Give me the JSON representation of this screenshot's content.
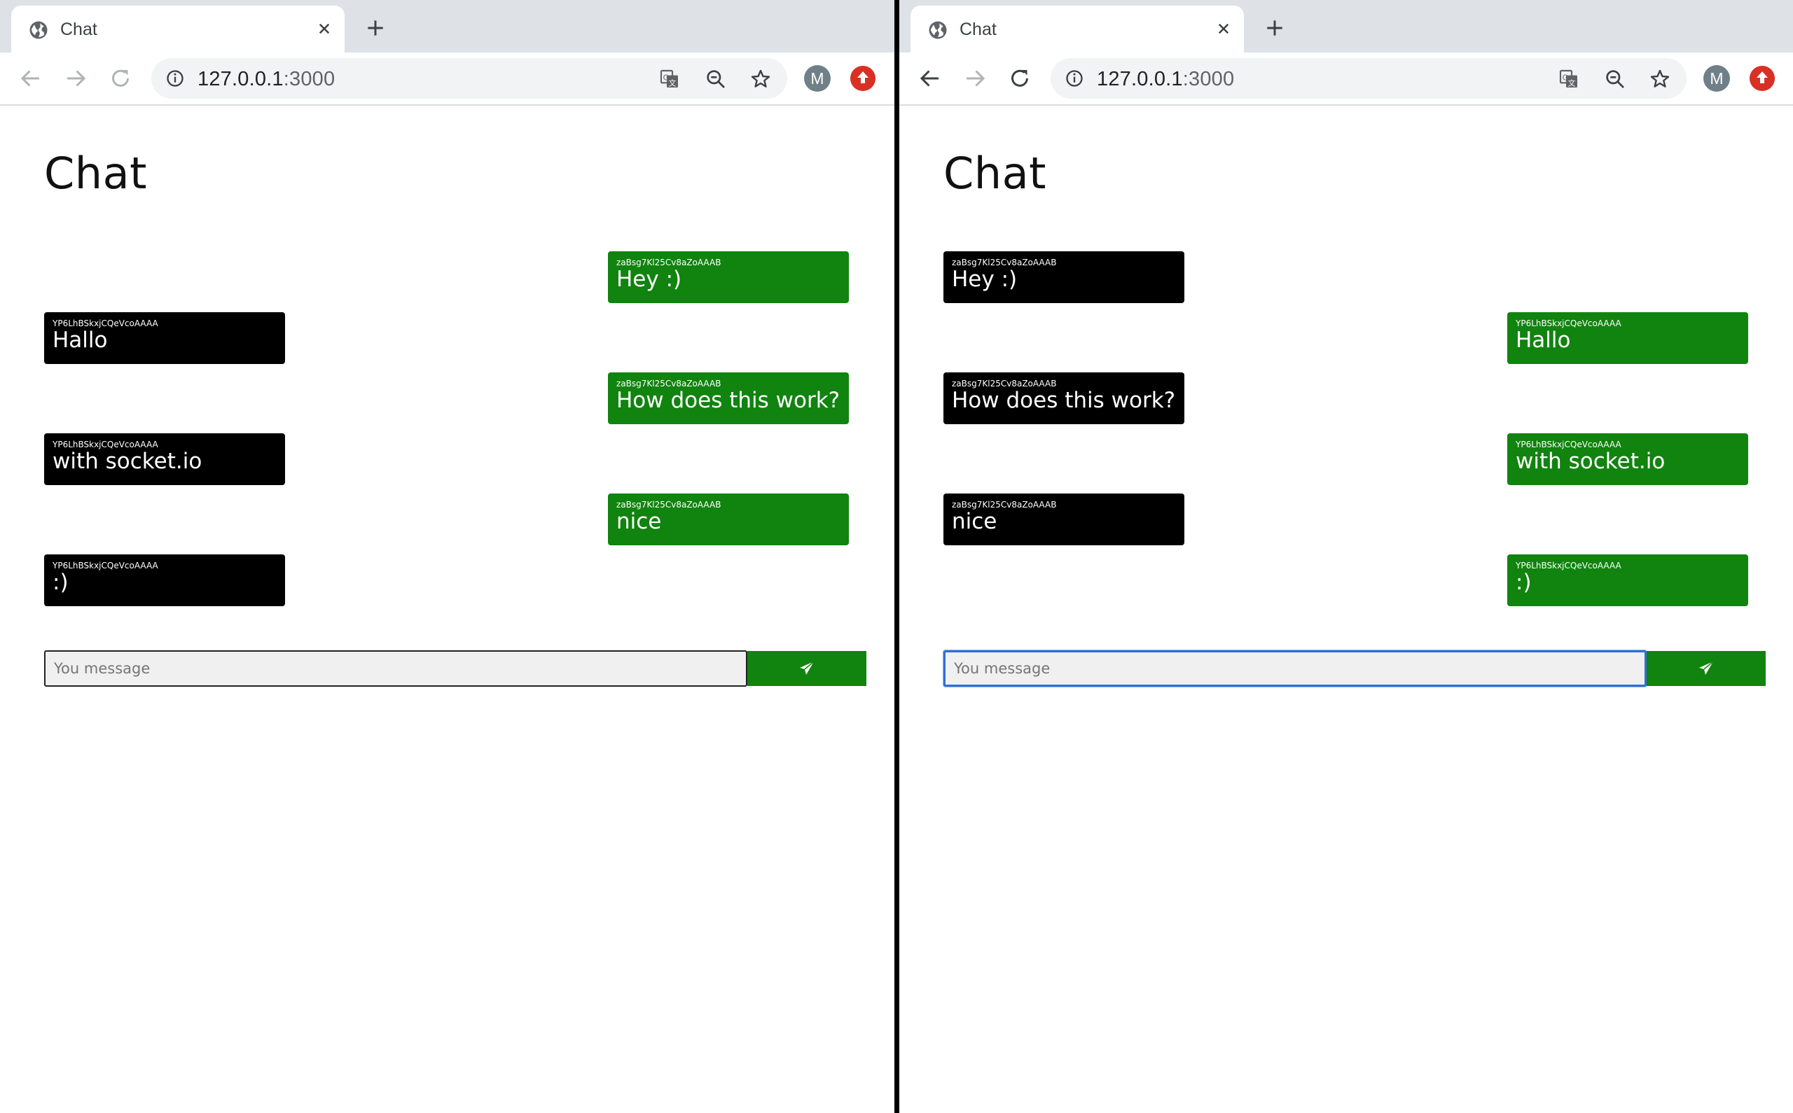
{
  "browser": {
    "tab_title": "Chat",
    "url_host": "127.0.0.1",
    "url_port": ":3000",
    "profile_initial": "M",
    "icons": [
      "globe-icon",
      "close-icon",
      "new-tab-icon",
      "back-icon",
      "forward-icon",
      "reload-icon",
      "info-icon",
      "translate-icon",
      "zoom-out-icon",
      "star-icon",
      "extension-icon"
    ]
  },
  "left": {
    "page_title": "Chat",
    "input_placeholder": "You message",
    "messages": [
      {
        "author": "zaBsg7Kl25Cv8aZoAAAB",
        "text": "Hey :)",
        "color": "green",
        "side": "right"
      },
      {
        "author": "YP6LhBSkxjCQeVcoAAAA",
        "text": "Hallo",
        "color": "black",
        "side": "left"
      },
      {
        "author": "zaBsg7Kl25Cv8aZoAAAB",
        "text": "How does this work?",
        "color": "green",
        "side": "right"
      },
      {
        "author": "YP6LhBSkxjCQeVcoAAAA",
        "text": "with socket.io",
        "color": "black",
        "side": "left"
      },
      {
        "author": "zaBsg7Kl25Cv8aZoAAAB",
        "text": "nice",
        "color": "green",
        "side": "right"
      },
      {
        "author": "YP6LhBSkxjCQeVcoAAAA",
        "text": ":)",
        "color": "black",
        "side": "left"
      }
    ]
  },
  "right": {
    "page_title": "Chat",
    "input_placeholder": "You message",
    "messages": [
      {
        "author": "zaBsg7Kl25Cv8aZoAAAB",
        "text": "Hey :)",
        "color": "black",
        "side": "left"
      },
      {
        "author": "YP6LhBSkxjCQeVcoAAAA",
        "text": "Hallo",
        "color": "green",
        "side": "right"
      },
      {
        "author": "zaBsg7Kl25Cv8aZoAAAB",
        "text": "How does this work?",
        "color": "black",
        "side": "left"
      },
      {
        "author": "YP6LhBSkxjCQeVcoAAAA",
        "text": "with socket.io",
        "color": "green",
        "side": "right"
      },
      {
        "author": "zaBsg7Kl25Cv8aZoAAAB",
        "text": "nice",
        "color": "black",
        "side": "left"
      },
      {
        "author": "YP6LhBSkxjCQeVcoAAAA",
        "text": ":)",
        "color": "green",
        "side": "right"
      }
    ]
  },
  "colors": {
    "accent_green": "#11830f",
    "bubble_black": "#000000",
    "focus_blue": "#2f6fd6"
  }
}
